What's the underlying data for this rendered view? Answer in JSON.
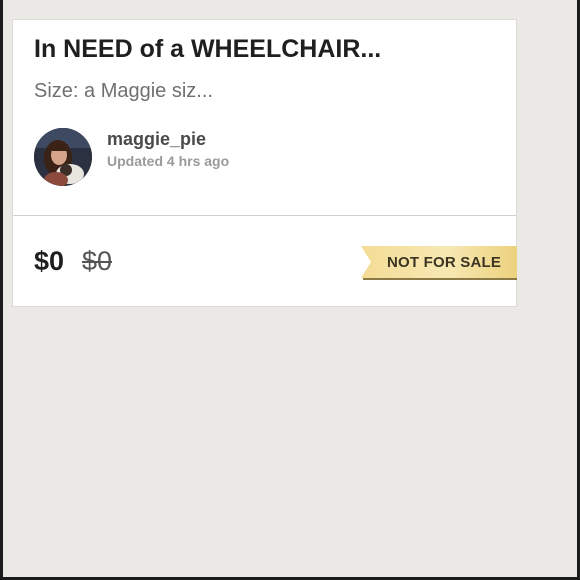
{
  "listing": {
    "title": "In NEED of a WHEELCHAIR...",
    "subtitle": "Size: a Maggie siz...",
    "seller": {
      "username": "maggie_pie",
      "updated": "Updated 4 hrs ago"
    },
    "price": "$0",
    "original_price": "$0",
    "badge": "NOT FOR SALE"
  },
  "colors": {
    "background": "#ebe9e5",
    "card": "#ffffff",
    "badge": "#f3dc95"
  },
  "icons": {
    "avatar": "user-photo"
  }
}
